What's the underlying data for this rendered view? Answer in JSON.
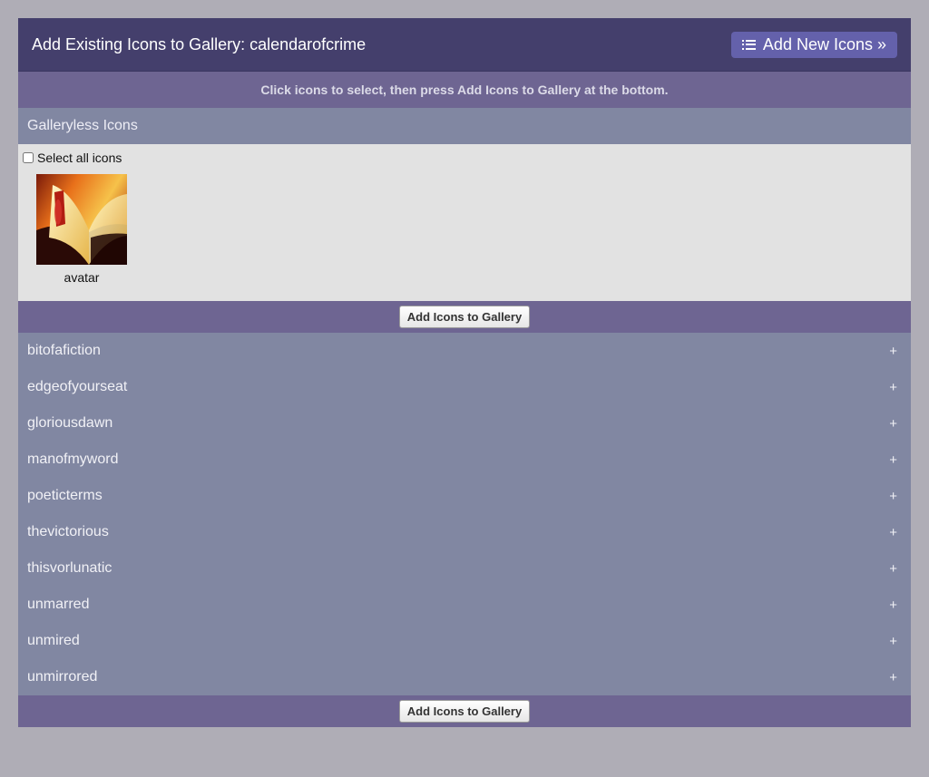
{
  "header": {
    "title": "Add Existing Icons to Gallery: calendarofcrime",
    "add_new_label": "Add New Icons »"
  },
  "instructions": "Click icons to select, then press Add Icons to Gallery at the bottom.",
  "galleryless": {
    "heading": "Galleryless Icons",
    "select_all_label": "Select all icons",
    "icons": [
      {
        "label": "avatar"
      }
    ]
  },
  "add_button_label": "Add Icons to Gallery",
  "galleries": [
    {
      "name": "bitofafiction",
      "toggle": "+"
    },
    {
      "name": "edgeofyourseat",
      "toggle": "+"
    },
    {
      "name": "gloriousdawn",
      "toggle": "+"
    },
    {
      "name": "manofmyword",
      "toggle": "+"
    },
    {
      "name": "poeticterms",
      "toggle": "+"
    },
    {
      "name": "thevictorious",
      "toggle": "+"
    },
    {
      "name": "thisvorlunatic",
      "toggle": "+"
    },
    {
      "name": "unmarred",
      "toggle": "+"
    },
    {
      "name": "unmired",
      "toggle": "+"
    },
    {
      "name": "unmirrored",
      "toggle": "+"
    }
  ],
  "colors": {
    "header_bg": "#443f6c",
    "accent_button": "#6461ab",
    "bar_bg": "#6e6592",
    "row_bg": "#8187a2",
    "page_bg": "#afadb6"
  }
}
